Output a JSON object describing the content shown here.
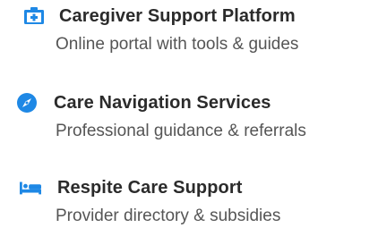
{
  "services": [
    {
      "icon": "medical-kit-icon",
      "title": "Caregiver Support Platform",
      "description": "Online portal with tools & guides"
    },
    {
      "icon": "compass-icon",
      "title": "Care Navigation Services",
      "description": "Professional guidance & referrals"
    },
    {
      "icon": "bed-icon",
      "title": "Respite Care Support",
      "description": "Provider directory & subsidies"
    }
  ],
  "colors": {
    "accent": "#1e88e5",
    "title": "#2b2b2b",
    "description": "#555555"
  }
}
